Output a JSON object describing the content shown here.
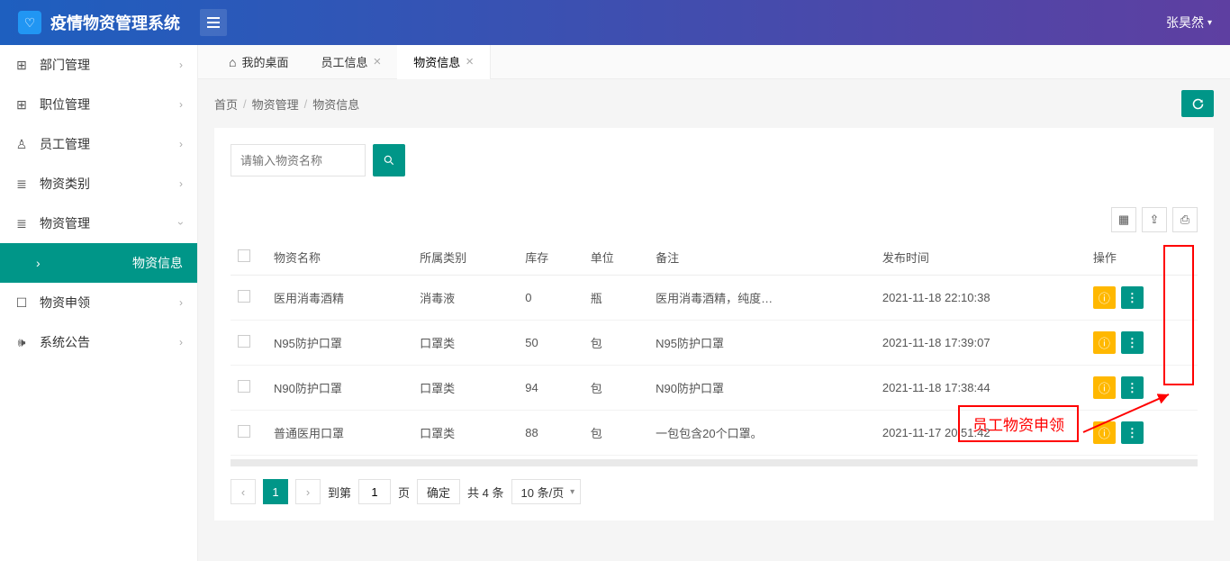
{
  "header": {
    "title": "疫情物资管理系统",
    "user": "张昊然"
  },
  "sidebar": {
    "items": [
      {
        "icon": "⊞",
        "label": "部门管理"
      },
      {
        "icon": "⊞",
        "label": "职位管理"
      },
      {
        "icon": "👤",
        "label": "员工管理"
      },
      {
        "icon": "≣",
        "label": "物资类别"
      },
      {
        "icon": "≣",
        "label": "物资管理"
      },
      {
        "icon": "☐",
        "label": "物资申领"
      },
      {
        "icon": "🔈",
        "label": "系统公告"
      }
    ],
    "sub_active": "物资信息"
  },
  "tabs": {
    "home": "我的桌面",
    "items": [
      "员工信息",
      "物资信息"
    ],
    "active": "物资信息"
  },
  "breadcrumb": [
    "首页",
    "物资管理",
    "物资信息"
  ],
  "search": {
    "placeholder": "请输入物资名称"
  },
  "table": {
    "headers": [
      "",
      "物资名称",
      "所属类别",
      "库存",
      "单位",
      "备注",
      "发布时间",
      "操作"
    ],
    "rows": [
      {
        "name": "医用消毒酒精",
        "cat": "消毒液",
        "stock": "0",
        "unit": "瓶",
        "remark": "医用消毒酒精，纯度…",
        "time": "2021-11-18 22:10:38"
      },
      {
        "name": "N95防护口罩",
        "cat": "口罩类",
        "stock": "50",
        "unit": "包",
        "remark": "N95防护口罩",
        "time": "2021-11-18 17:39:07"
      },
      {
        "name": "N90防护口罩",
        "cat": "口罩类",
        "stock": "94",
        "unit": "包",
        "remark": "N90防护口罩",
        "time": "2021-11-18 17:38:44"
      },
      {
        "name": "普通医用口罩",
        "cat": "口罩类",
        "stock": "88",
        "unit": "包",
        "remark": "一包包含20个口罩。",
        "time": "2021-11-17 20:51:42"
      }
    ]
  },
  "pager": {
    "cur": "1",
    "goto_label": "到第",
    "page_input": "1",
    "page_unit": "页",
    "confirm": "确定",
    "total": "共 4 条",
    "per": "10 条/页"
  },
  "annotation": "员工物资申领"
}
